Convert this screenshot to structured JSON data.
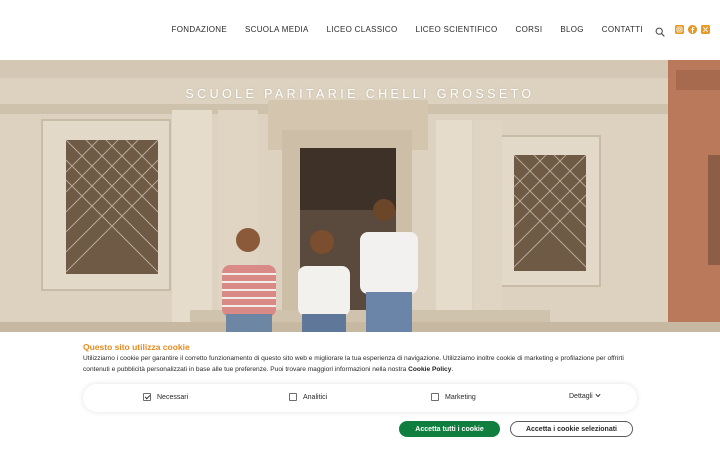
{
  "nav": {
    "items": [
      "FONDAZIONE",
      "SCUOLA MEDIA",
      "LICEO CLASSICO",
      "LICEO SCIENTIFICO",
      "CORSI",
      "BLOG",
      "CONTATTI"
    ],
    "icons": [
      "search-icon",
      "instagram-icon",
      "facebook-icon",
      "x-icon"
    ]
  },
  "hero": {
    "title": "SCUOLE PARITARIE CHELLI GROSSETO"
  },
  "cookie": {
    "title": "Questo sito utilizza cookie",
    "text": "Utilizziamo i cookie per garantire il corretto funzionamento di questo sito web e migliorare la tua esperienza di navigazione. Utilizziamo inoltre cookie di marketing e profilazione per offrirti contenuti e pubblicità personalizzati in base alle tue preferenze. Puoi trovare maggiori informazioni nella nostra",
    "policy_link": "Cookie Policy",
    "text_end": ".",
    "options": {
      "necessary": {
        "label": "Necessari",
        "checked": true
      },
      "analytics": {
        "label": "Analitici",
        "checked": false
      },
      "marketing": {
        "label": "Marketing",
        "checked": false
      },
      "details": {
        "label": "Dettagli"
      }
    },
    "buttons": {
      "accept_all": "Accetta tutti i cookie",
      "accept_selected": "Accetta i cookie selezionati"
    }
  },
  "colors": {
    "accent_orange": "#e58b23",
    "accept_green": "#107e3f"
  }
}
